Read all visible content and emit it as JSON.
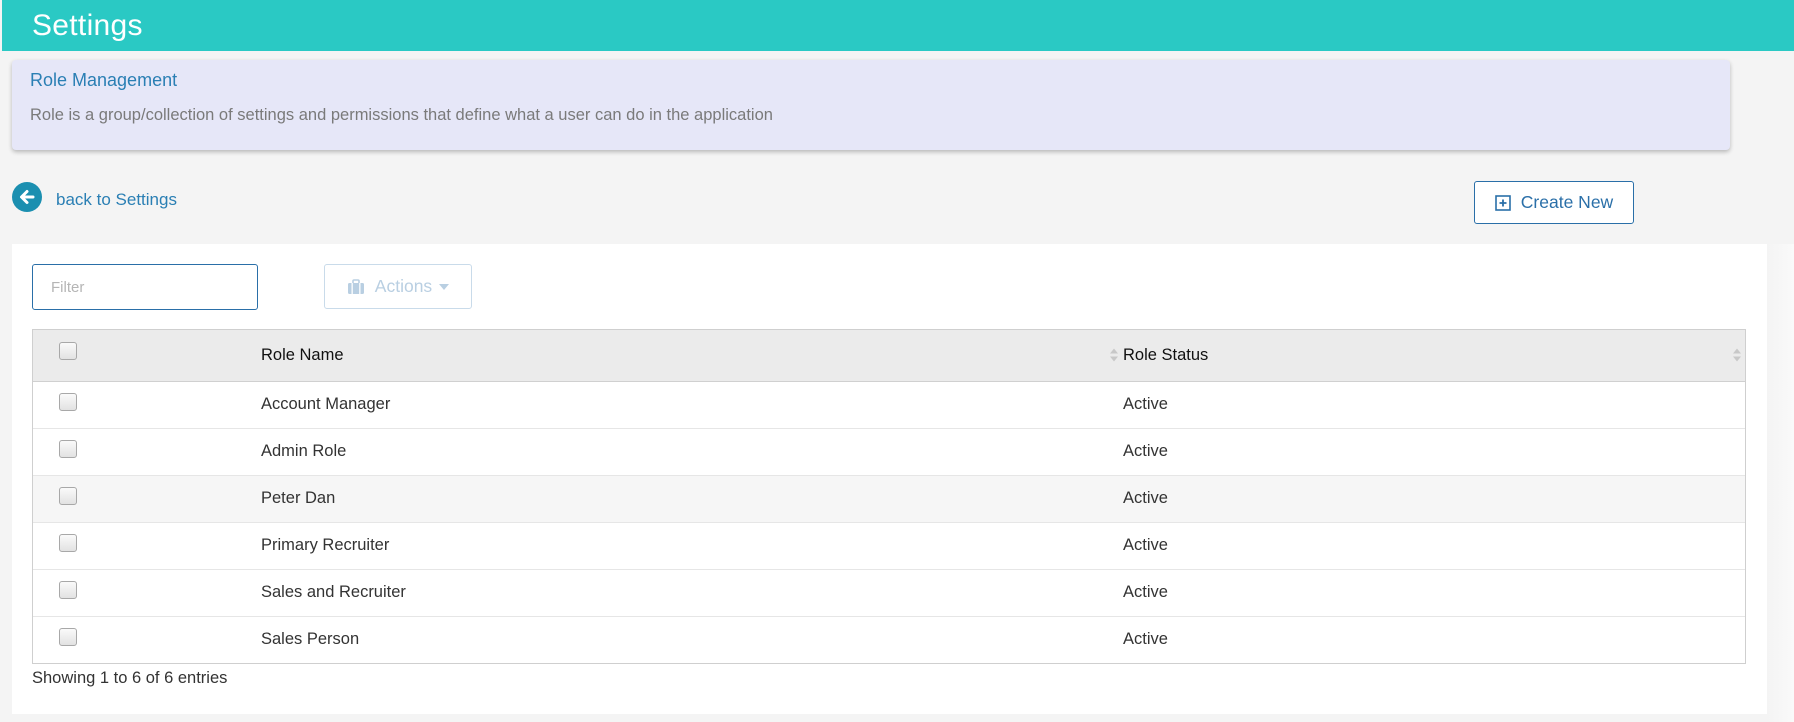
{
  "header": {
    "title": "Settings"
  },
  "info": {
    "title": "Role Management",
    "description": "Role is a group/collection of settings and permissions that define what a user can do in the application"
  },
  "nav": {
    "back_label": "back to Settings"
  },
  "toolbar": {
    "create_label": "Create New",
    "filter_placeholder": "Filter",
    "actions_label": "Actions"
  },
  "table": {
    "columns": [
      "Role Name",
      "Role Status"
    ],
    "rows": [
      {
        "name": "Account Manager",
        "status": "Active"
      },
      {
        "name": "Admin Role",
        "status": "Active"
      },
      {
        "name": "Peter Dan",
        "status": "Active"
      },
      {
        "name": "Primary Recruiter",
        "status": "Active"
      },
      {
        "name": "Sales and Recruiter",
        "status": "Active"
      },
      {
        "name": "Sales Person",
        "status": "Active"
      }
    ]
  },
  "footer": {
    "info": "Showing 1 to 6 of 6 entries"
  },
  "colors": {
    "header_bg": "#2ac9c4",
    "info_bg": "#e6e7f8",
    "accent": "#2a7fb4"
  }
}
